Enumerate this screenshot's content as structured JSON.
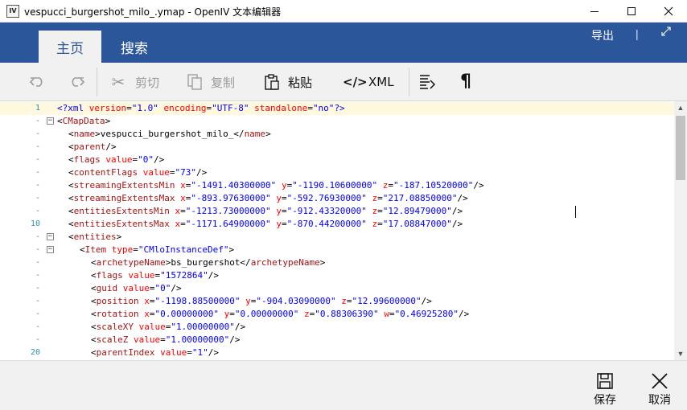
{
  "window": {
    "app_icon": "IV",
    "title": "vespucci_burgershot_milo_.ymap - OpenIV 文本编辑器"
  },
  "ribbon": {
    "tabs": [
      {
        "label": "主页"
      },
      {
        "label": "搜索"
      }
    ],
    "export_label": "导出",
    "separator": "|",
    "expand_icon": "expand-icon"
  },
  "toolbar": {
    "undo_icon": "undo-icon",
    "redo_icon": "redo-icon",
    "cut_label": "剪切",
    "copy_label": "复制",
    "paste_label": "粘贴",
    "xml_label": "XML",
    "xml_icon_text": "</>",
    "format_icon": "format-icon",
    "pilcrow_text": "¶"
  },
  "editor": {
    "lines": [
      {
        "n": "1",
        "fold": "",
        "indent": 0,
        "tokens": [
          [
            "pi",
            "<?xml "
          ],
          [
            "attr",
            "version"
          ],
          [
            "txt",
            "="
          ],
          [
            "val",
            "\"1.0\""
          ],
          [
            "txt",
            " "
          ],
          [
            "attr",
            "encoding"
          ],
          [
            "txt",
            "="
          ],
          [
            "val",
            "\"UTF-8\""
          ],
          [
            "txt",
            " "
          ],
          [
            "attr",
            "standalone"
          ],
          [
            "txt",
            "="
          ],
          [
            "val",
            "\"no\""
          ],
          [
            "pi",
            "?>"
          ]
        ]
      },
      {
        "n": "-",
        "fold": "−",
        "indent": 0,
        "tokens": [
          [
            "txt",
            "<"
          ],
          [
            "tag",
            "CMapData"
          ],
          [
            "txt",
            ">"
          ]
        ]
      },
      {
        "n": "-",
        "fold": "",
        "indent": 1,
        "tokens": [
          [
            "txt",
            "<"
          ],
          [
            "tag",
            "name"
          ],
          [
            "txt",
            ">vespucci_burgershot_milo_</"
          ],
          [
            "tag",
            "name"
          ],
          [
            "txt",
            ">"
          ]
        ]
      },
      {
        "n": "-",
        "fold": "",
        "indent": 1,
        "tokens": [
          [
            "txt",
            "<"
          ],
          [
            "tag",
            "parent"
          ],
          [
            "txt",
            "/>"
          ]
        ]
      },
      {
        "n": "-",
        "fold": "",
        "indent": 1,
        "tokens": [
          [
            "txt",
            "<"
          ],
          [
            "tag",
            "flags"
          ],
          [
            "txt",
            " "
          ],
          [
            "attr",
            "value"
          ],
          [
            "txt",
            "="
          ],
          [
            "val",
            "\"0\""
          ],
          [
            "txt",
            "/>"
          ]
        ]
      },
      {
        "n": "-",
        "fold": "",
        "indent": 1,
        "tokens": [
          [
            "txt",
            "<"
          ],
          [
            "tag",
            "contentFlags"
          ],
          [
            "txt",
            " "
          ],
          [
            "attr",
            "value"
          ],
          [
            "txt",
            "="
          ],
          [
            "val",
            "\"73\""
          ],
          [
            "txt",
            "/>"
          ]
        ]
      },
      {
        "n": "-",
        "fold": "",
        "indent": 1,
        "tokens": [
          [
            "txt",
            "<"
          ],
          [
            "tag",
            "streamingExtentsMin"
          ],
          [
            "txt",
            " "
          ],
          [
            "attr",
            "x"
          ],
          [
            "txt",
            "="
          ],
          [
            "val",
            "\"-1491.40300000\""
          ],
          [
            "txt",
            " "
          ],
          [
            "attr",
            "y"
          ],
          [
            "txt",
            "="
          ],
          [
            "val",
            "\"-1190.10600000\""
          ],
          [
            "txt",
            " "
          ],
          [
            "attr",
            "z"
          ],
          [
            "txt",
            "="
          ],
          [
            "val",
            "\"-187.10520000\""
          ],
          [
            "txt",
            "/>"
          ]
        ]
      },
      {
        "n": "-",
        "fold": "",
        "indent": 1,
        "tokens": [
          [
            "txt",
            "<"
          ],
          [
            "tag",
            "streamingExtentsMax"
          ],
          [
            "txt",
            " "
          ],
          [
            "attr",
            "x"
          ],
          [
            "txt",
            "="
          ],
          [
            "val",
            "\"-893.97630000\""
          ],
          [
            "txt",
            " "
          ],
          [
            "attr",
            "y"
          ],
          [
            "txt",
            "="
          ],
          [
            "val",
            "\"-592.76930000\""
          ],
          [
            "txt",
            " "
          ],
          [
            "attr",
            "z"
          ],
          [
            "txt",
            "="
          ],
          [
            "val",
            "\"217.08850000\""
          ],
          [
            "txt",
            "/>"
          ]
        ]
      },
      {
        "n": "-",
        "fold": "",
        "indent": 1,
        "tokens": [
          [
            "txt",
            "<"
          ],
          [
            "tag",
            "entitiesExtentsMin"
          ],
          [
            "txt",
            " "
          ],
          [
            "attr",
            "x"
          ],
          [
            "txt",
            "="
          ],
          [
            "val",
            "\"-1213.73000000\""
          ],
          [
            "txt",
            " "
          ],
          [
            "attr",
            "y"
          ],
          [
            "txt",
            "="
          ],
          [
            "val",
            "\"-912.43320000\""
          ],
          [
            "txt",
            " "
          ],
          [
            "attr",
            "z"
          ],
          [
            "txt",
            "="
          ],
          [
            "val",
            "\"12.89479000\""
          ],
          [
            "txt",
            "/>"
          ]
        ]
      },
      {
        "n": "10",
        "fold": "",
        "indent": 1,
        "tokens": [
          [
            "txt",
            "<"
          ],
          [
            "tag",
            "entitiesExtentsMax"
          ],
          [
            "txt",
            " "
          ],
          [
            "attr",
            "x"
          ],
          [
            "txt",
            "="
          ],
          [
            "val",
            "\"-1171.64900000\""
          ],
          [
            "txt",
            " "
          ],
          [
            "attr",
            "y"
          ],
          [
            "txt",
            "="
          ],
          [
            "val",
            "\"-870.44200000\""
          ],
          [
            "txt",
            " "
          ],
          [
            "attr",
            "z"
          ],
          [
            "txt",
            "="
          ],
          [
            "val",
            "\"17.08847000\""
          ],
          [
            "txt",
            "/>"
          ]
        ]
      },
      {
        "n": "-",
        "fold": "−",
        "indent": 1,
        "tokens": [
          [
            "txt",
            "<"
          ],
          [
            "tag",
            "entities"
          ],
          [
            "txt",
            ">"
          ]
        ]
      },
      {
        "n": "-",
        "fold": "−",
        "indent": 2,
        "tokens": [
          [
            "txt",
            "<"
          ],
          [
            "tag",
            "Item"
          ],
          [
            "txt",
            " "
          ],
          [
            "attr",
            "type"
          ],
          [
            "txt",
            "="
          ],
          [
            "val",
            "\"CMloInstanceDef\""
          ],
          [
            "txt",
            ">"
          ]
        ]
      },
      {
        "n": "-",
        "fold": "",
        "indent": 3,
        "tokens": [
          [
            "txt",
            "<"
          ],
          [
            "tag",
            "archetypeName"
          ],
          [
            "txt",
            ">bs_burgershot</"
          ],
          [
            "tag",
            "archetypeName"
          ],
          [
            "txt",
            ">"
          ]
        ]
      },
      {
        "n": "-",
        "fold": "",
        "indent": 3,
        "tokens": [
          [
            "txt",
            "<"
          ],
          [
            "tag",
            "flags"
          ],
          [
            "txt",
            " "
          ],
          [
            "attr",
            "value"
          ],
          [
            "txt",
            "="
          ],
          [
            "val",
            "\"1572864\""
          ],
          [
            "txt",
            "/>"
          ]
        ]
      },
      {
        "n": "-",
        "fold": "",
        "indent": 3,
        "tokens": [
          [
            "txt",
            "<"
          ],
          [
            "tag",
            "guid"
          ],
          [
            "txt",
            " "
          ],
          [
            "attr",
            "value"
          ],
          [
            "txt",
            "="
          ],
          [
            "val",
            "\"0\""
          ],
          [
            "txt",
            "/>"
          ]
        ]
      },
      {
        "n": "-",
        "fold": "",
        "indent": 3,
        "tokens": [
          [
            "txt",
            "<"
          ],
          [
            "tag",
            "position"
          ],
          [
            "txt",
            " "
          ],
          [
            "attr",
            "x"
          ],
          [
            "txt",
            "="
          ],
          [
            "val",
            "\"-1198.88500000\""
          ],
          [
            "txt",
            " "
          ],
          [
            "attr",
            "y"
          ],
          [
            "txt",
            "="
          ],
          [
            "val",
            "\"-904.03090000\""
          ],
          [
            "txt",
            " "
          ],
          [
            "attr",
            "z"
          ],
          [
            "txt",
            "="
          ],
          [
            "val",
            "\"12.99600000\""
          ],
          [
            "txt",
            "/>"
          ]
        ]
      },
      {
        "n": "-",
        "fold": "",
        "indent": 3,
        "tokens": [
          [
            "txt",
            "<"
          ],
          [
            "tag",
            "rotation"
          ],
          [
            "txt",
            " "
          ],
          [
            "attr",
            "x"
          ],
          [
            "txt",
            "="
          ],
          [
            "val",
            "\"0.00000000\""
          ],
          [
            "txt",
            " "
          ],
          [
            "attr",
            "y"
          ],
          [
            "txt",
            "="
          ],
          [
            "val",
            "\"0.00000000\""
          ],
          [
            "txt",
            " "
          ],
          [
            "attr",
            "z"
          ],
          [
            "txt",
            "="
          ],
          [
            "val",
            "\"0.88306390\""
          ],
          [
            "txt",
            " "
          ],
          [
            "attr",
            "w"
          ],
          [
            "txt",
            "="
          ],
          [
            "val",
            "\"0.46925280\""
          ],
          [
            "txt",
            "/>"
          ]
        ]
      },
      {
        "n": "-",
        "fold": "",
        "indent": 3,
        "tokens": [
          [
            "txt",
            "<"
          ],
          [
            "tag",
            "scaleXY"
          ],
          [
            "txt",
            " "
          ],
          [
            "attr",
            "value"
          ],
          [
            "txt",
            "="
          ],
          [
            "val",
            "\"1.00000000\""
          ],
          [
            "txt",
            "/>"
          ]
        ]
      },
      {
        "n": "-",
        "fold": "",
        "indent": 3,
        "tokens": [
          [
            "txt",
            "<"
          ],
          [
            "tag",
            "scaleZ"
          ],
          [
            "txt",
            " "
          ],
          [
            "attr",
            "value"
          ],
          [
            "txt",
            "="
          ],
          [
            "val",
            "\"1.00000000\""
          ],
          [
            "txt",
            "/>"
          ]
        ]
      },
      {
        "n": "20",
        "fold": "",
        "indent": 3,
        "tokens": [
          [
            "txt",
            "<"
          ],
          [
            "tag",
            "parentIndex"
          ],
          [
            "txt",
            " "
          ],
          [
            "attr",
            "value"
          ],
          [
            "txt",
            "="
          ],
          [
            "val",
            "\"1\""
          ],
          [
            "txt",
            "/>"
          ]
        ]
      }
    ]
  },
  "actions": {
    "save_label": "保存",
    "cancel_label": "取消"
  },
  "colors": {
    "ribbon": "#2b579a",
    "tag": "#a31515",
    "attribute": "#ff0000",
    "value": "#0000ff",
    "line_number": "#2b91af",
    "current_line": "#fdf8de"
  }
}
